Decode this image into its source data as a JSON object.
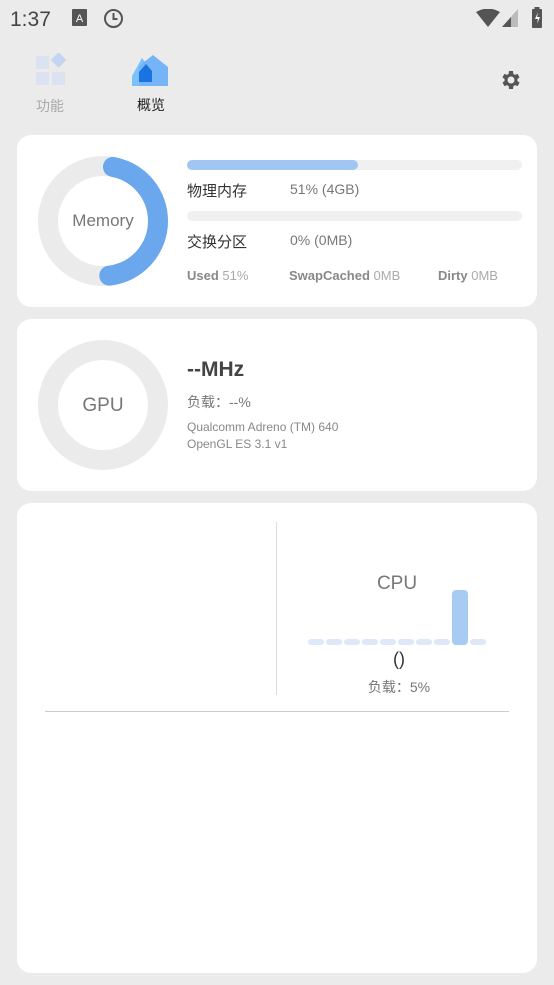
{
  "status_bar": {
    "time": "1:37",
    "icons": [
      "keyboard-a-icon",
      "clock-icon",
      "wifi-icon",
      "signal-icon",
      "battery-charging-icon"
    ]
  },
  "nav": {
    "tabs": [
      {
        "label": "功能",
        "icon": "grid-icon",
        "active": false
      },
      {
        "label": "概览",
        "icon": "home-icon",
        "active": true
      }
    ],
    "settings_icon": "gear-icon"
  },
  "memory": {
    "ring_label": "Memory",
    "used_fraction": 0.51,
    "physical_label": "物理内存",
    "physical_value": "51% (4GB)",
    "physical_fraction": 0.51,
    "swap_label": "交换分区",
    "swap_value": "0% (0MB)",
    "swap_fraction": 0,
    "stats": [
      {
        "key": "Used",
        "value": "51%"
      },
      {
        "key": "SwapCached",
        "value": "0MB"
      },
      {
        "key": "Dirty",
        "value": "0MB"
      }
    ]
  },
  "gpu": {
    "ring_label": "GPU",
    "freq": "--MHz",
    "load": "负载：--%",
    "renderer": "Qualcomm Adreno (TM) 640",
    "api": "OpenGL ES 3.1 v1"
  },
  "cpu": {
    "title": "CPU",
    "freq": "()",
    "load": "负载：5%",
    "history_percent": [
      0,
      0,
      0,
      0,
      0,
      0,
      0,
      0,
      55,
      0
    ]
  },
  "colors": {
    "accent": "#6aa7ec",
    "bar_light": "#dde9f8",
    "bar_strong": "#a8cbf3",
    "ring_bg": "#ebebeb"
  }
}
